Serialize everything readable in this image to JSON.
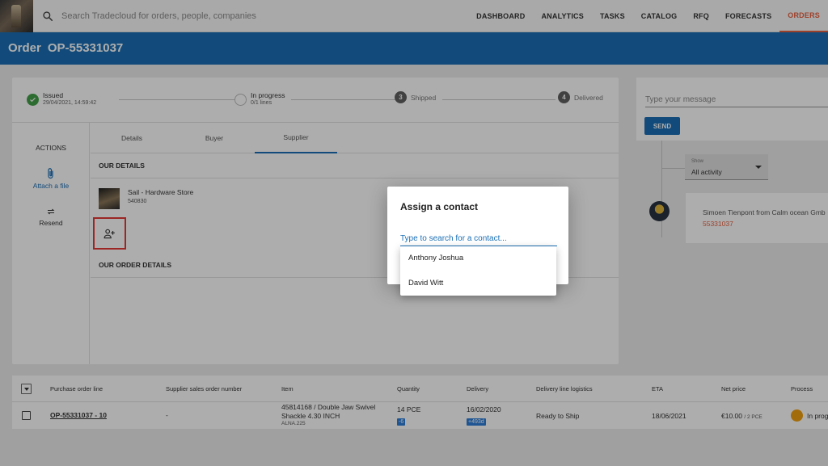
{
  "topbar": {
    "search_placeholder": "Search Tradecloud for orders, people, companies",
    "nav": [
      "DASHBOARD",
      "ANALYTICS",
      "TASKS",
      "CATALOG",
      "RFQ",
      "FORECASTS",
      "ORDERS"
    ],
    "active_nav": "ORDERS"
  },
  "order": {
    "label": "Order",
    "number": "OP-55331037"
  },
  "stepper": [
    {
      "title": "Issued",
      "sub": "29/04/2021, 14:59:42",
      "state": "done"
    },
    {
      "title": "In progress",
      "sub": "0/1  lines",
      "state": "current"
    },
    {
      "number": "3",
      "title": "Shipped",
      "state": "pending"
    },
    {
      "number": "4",
      "title": "Delivered",
      "state": "pending"
    }
  ],
  "actions": {
    "title": "ACTIONS",
    "attach_label": "Attach a file",
    "resend_label": "Resend"
  },
  "tabs": [
    "Details",
    "Buyer",
    "Supplier"
  ],
  "active_tab": "Supplier",
  "supplier": {
    "our_details": "OUR DETAILS",
    "name": "Sail - Hardware Store",
    "code": "540830",
    "our_order_details": "OUR ORDER DETAILS"
  },
  "chat": {
    "placeholder": "Type your message",
    "send_label": "SEND",
    "filter_label": "Show",
    "filter_value": "All activity",
    "message": "Simoen Tienpont from Calm ocean Gmb",
    "message_link": "55331037"
  },
  "table": {
    "headers": [
      "Purchase order line",
      "Supplier sales order number",
      "Item",
      "Quantity",
      "Delivery",
      "Delivery line logistics",
      "ETA",
      "Net price",
      "Process"
    ],
    "row": {
      "line": "OP-55331037 - 10",
      "supplier_order": "-",
      "item_line1": "45814168 / Double Jaw Swivel",
      "item_line2": "Shackle 4.30 INCH",
      "item_code": "ALNA.225",
      "quantity": "14 PCE",
      "quantity_chip": "-6",
      "delivery": "16/02/2020",
      "delivery_chip": "+493d",
      "logistics": "Ready to Ship",
      "eta": "18/06/2021",
      "price": "€10.00",
      "price_unit": "/ 2 PCE",
      "process": "In prog"
    }
  },
  "dialog": {
    "title": "Assign a contact",
    "search_placeholder": "Type to search for a contact...",
    "options": [
      "Anthony Joshua",
      "David Witt"
    ]
  },
  "colors": {
    "primary": "#1b6fb5",
    "accent": "#e8613f",
    "success": "#43a047",
    "highlight": "#e53935"
  }
}
